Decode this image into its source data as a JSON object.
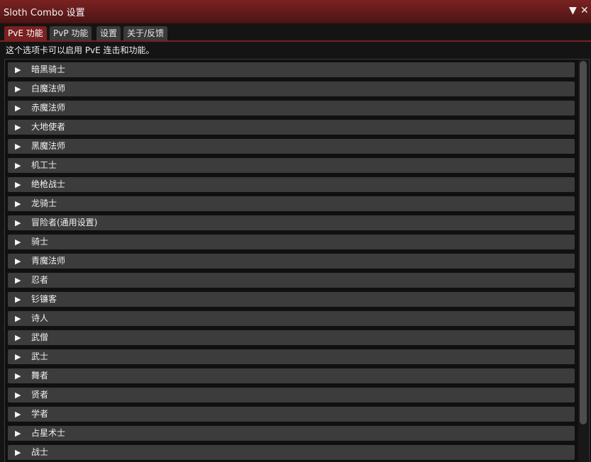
{
  "window": {
    "title": "Sloth Combo 设置",
    "collapse_icon": "▼",
    "close_icon": "✕"
  },
  "tabs": [
    {
      "label": "PvE 功能",
      "active": true
    },
    {
      "label": "PvP 功能",
      "active": false
    },
    {
      "label": "设置",
      "active": false
    },
    {
      "label": "关于/反馈",
      "active": false
    }
  ],
  "description": "这个选项卡可以启用 PvE 连击和功能。",
  "list": {
    "arrow_glyph": "▶",
    "items": [
      "暗黑骑士",
      "白魔法师",
      "赤魔法师",
      "大地使者",
      "黑魔法师",
      "机工士",
      "绝枪战士",
      "龙骑士",
      "冒险者(通用设置)",
      "骑士",
      "青魔法师",
      "忍者",
      "钐镰客",
      "诗人",
      "武僧",
      "武士",
      "舞者",
      "贤者",
      "学者",
      "占星术士",
      "战士"
    ]
  },
  "colors": {
    "accent": "#7a2020",
    "item_bg": "#3c3c3c",
    "panel_bg": "#101010"
  }
}
